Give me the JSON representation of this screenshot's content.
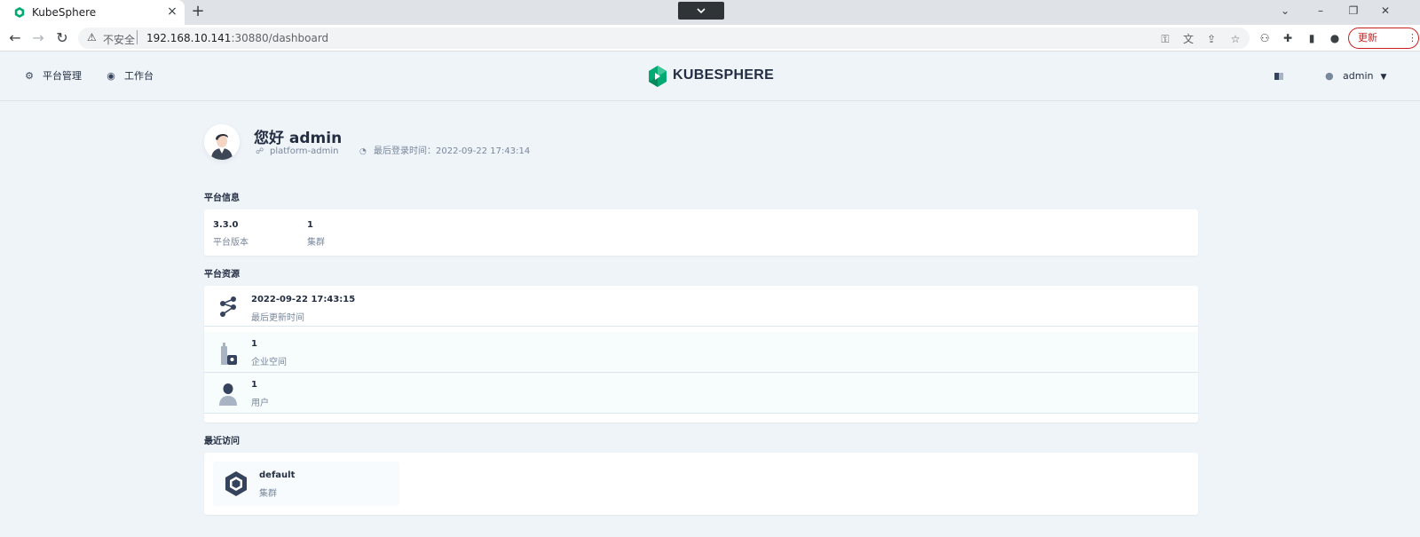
{
  "browser": {
    "tab_title": "KubeSphere",
    "new_tab": "+",
    "tab_close": "×",
    "security_label": "不安全",
    "url_host": "192.168.10.141",
    "url_rest": ":30880/dashboard",
    "update_label": "更新"
  },
  "header": {
    "nav_platform": "平台管理",
    "nav_workbench": "工作台",
    "logo_text": "KUBESPHERE",
    "user_name": "admin"
  },
  "greeting": {
    "title": "您好 admin",
    "role": "platform-admin",
    "last_login": "最后登录时间：2022-09-22 17:43:14"
  },
  "platform_info": {
    "section_title": "平台信息",
    "version_value": "3.3.0",
    "version_label": "平台版本",
    "cluster_value": "1",
    "cluster_label": "集群"
  },
  "platform_resources": {
    "section_title": "平台资源",
    "items": [
      {
        "value": "2022-09-22 17:43:15",
        "label": "最后更新时间",
        "icon": "share-nodes-icon"
      },
      {
        "value": "1",
        "label": "企业空间",
        "icon": "workspace-icon"
      },
      {
        "value": "1",
        "label": "用户",
        "icon": "user-icon"
      }
    ]
  },
  "recent_access": {
    "section_title": "最近访问",
    "items": [
      {
        "name": "default",
        "label": "集群",
        "icon": "cluster-cube-icon"
      }
    ]
  },
  "colors": {
    "page_bg": "#eff4f9",
    "brand_green": "#00aa72",
    "text_primary": "#242e42",
    "text_secondary": "#79879c"
  }
}
